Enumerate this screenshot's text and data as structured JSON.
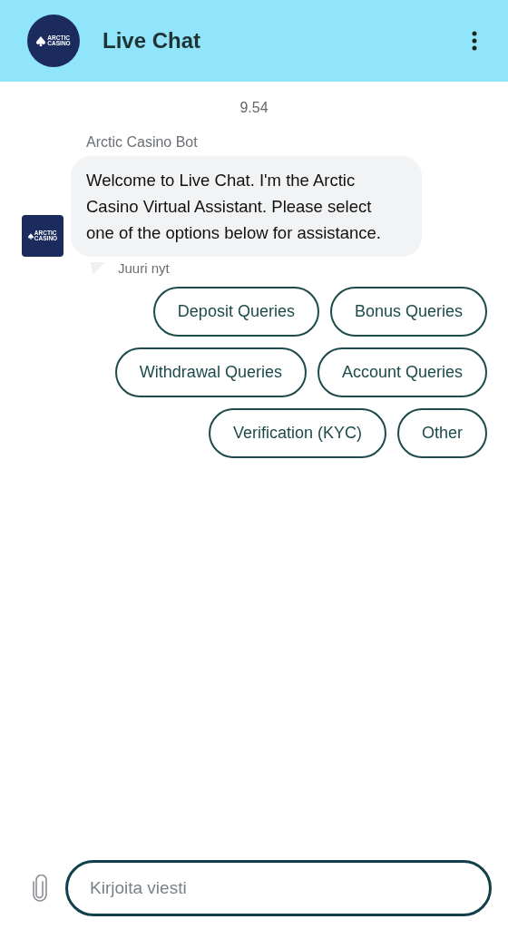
{
  "header": {
    "logo_text": [
      "ARCTIC",
      "CASINO"
    ],
    "title": "Live Chat"
  },
  "chat": {
    "timestamp": "9.54",
    "sender": "Arctic Casino Bot",
    "avatar_text": [
      "ARCTIC",
      "CASINO"
    ],
    "message": "Welcome to Live Chat. I'm the Arctic Casino Virtual Assistant. Please select one of the options below for assistance.",
    "status": "Juuri nyt",
    "options": [
      "Deposit Queries",
      "Bonus Queries",
      "Withdrawal Queries",
      "Account Queries",
      "Verification (KYC)",
      "Other"
    ]
  },
  "composer": {
    "placeholder": "Kirjoita viesti"
  }
}
